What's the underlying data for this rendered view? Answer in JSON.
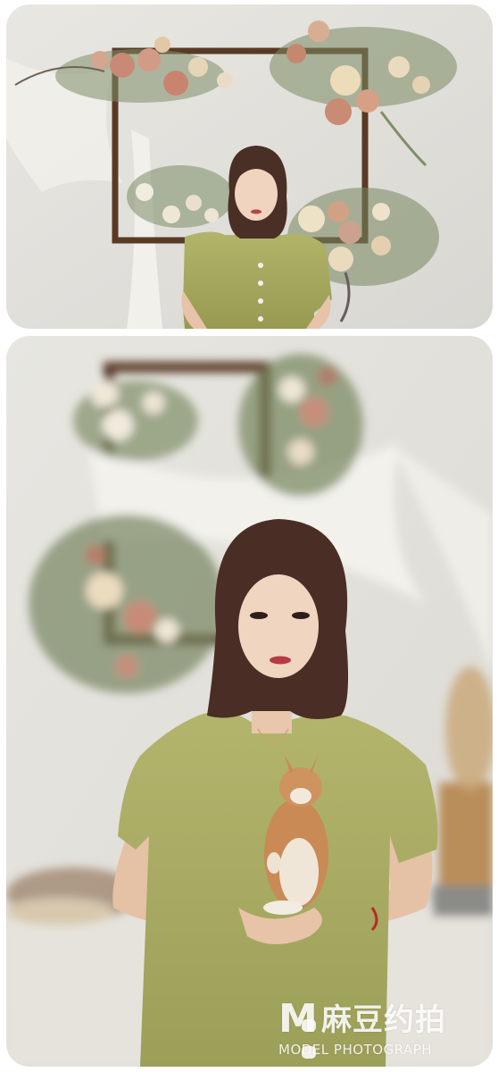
{
  "watermark": {
    "logo_letter": "M",
    "brand_cn": "麻豆约拍",
    "brand_en": "MODEL PHOTOGRAPH"
  }
}
